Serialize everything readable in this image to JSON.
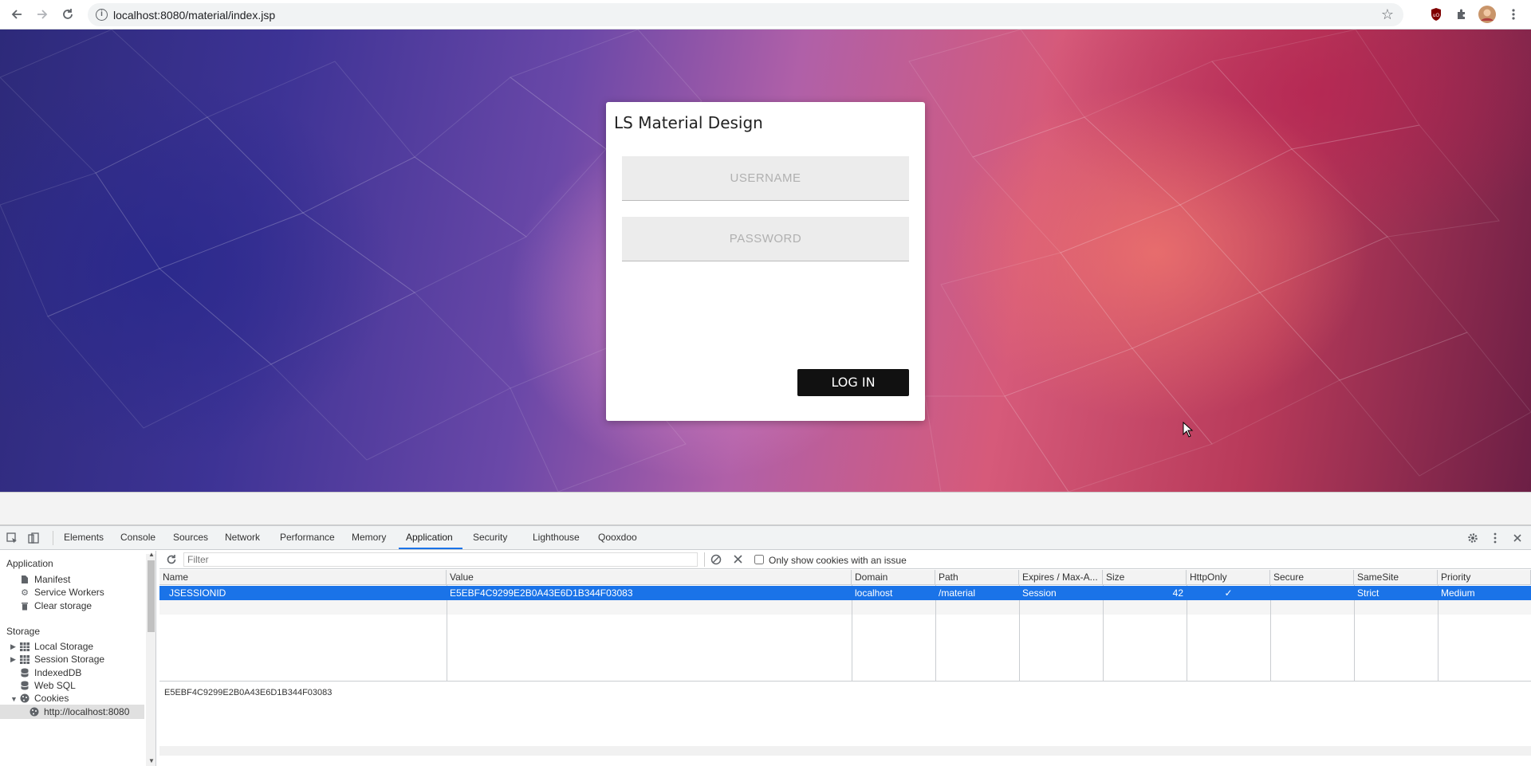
{
  "browser": {
    "url": "localhost:8080/material/index.jsp"
  },
  "login": {
    "title": "LS Material Design",
    "username_placeholder": "USERNAME",
    "password_placeholder": "PASSWORD",
    "login_label": "LOG IN"
  },
  "devtools": {
    "tabs": [
      "Elements",
      "Console",
      "Sources",
      "Network",
      "Performance",
      "Memory",
      "Application",
      "Security",
      "Lighthouse",
      "Qooxdoo"
    ],
    "active_tab": "Application",
    "sidebar": {
      "application_header": "Application",
      "application_items": [
        "Manifest",
        "Service Workers",
        "Clear storage"
      ],
      "storage_header": "Storage",
      "storage_items": [
        "Local Storage",
        "Session Storage",
        "IndexedDB",
        "Web SQL",
        "Cookies"
      ],
      "cookie_origin": "http://localhost:8080"
    },
    "filter": {
      "placeholder": "Filter",
      "only_issues_label": "Only show cookies with an issue"
    },
    "table": {
      "headers": [
        "Name",
        "Value",
        "Domain",
        "Path",
        "Expires / Max-A...",
        "Size",
        "HttpOnly",
        "Secure",
        "SameSite",
        "Priority"
      ],
      "rows": [
        {
          "name": "JSESSIONID",
          "value": "E5EBF4C9299E2B0A43E6D1B344F03083",
          "domain": "localhost",
          "path": "/material",
          "expires": "Session",
          "size": "42",
          "httponly": "✓",
          "secure": "",
          "samesite": "Strict",
          "priority": "Medium"
        }
      ]
    },
    "value_preview": "E5EBF4C9299E2B0A43E6D1B344F03083"
  }
}
